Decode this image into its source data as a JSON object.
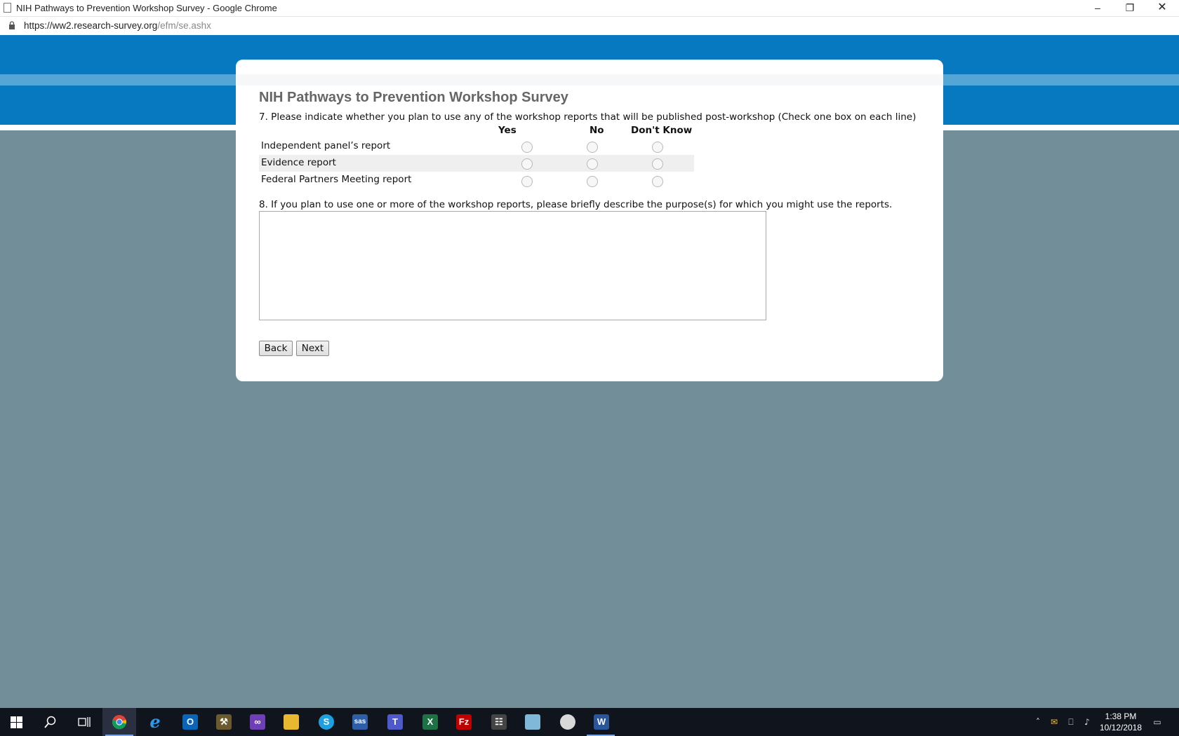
{
  "window": {
    "title": "NIH Pathways to Prevention Workshop Survey - Google Chrome",
    "url_host": "https://ww2.research-survey.org",
    "url_path": "/efm/se.ashx"
  },
  "survey": {
    "title": "NIH Pathways to Prevention Workshop Survey",
    "q7": {
      "text": "7. Please indicate whether you plan to use any of the workshop reports that will be published post-workshop (Check one box on each line)",
      "columns": [
        "Yes",
        "No",
        "Don't Know"
      ],
      "rows": [
        {
          "label": "Independent panel’s report"
        },
        {
          "label": "Evidence report"
        },
        {
          "label": "Federal Partners Meeting report"
        }
      ]
    },
    "q8": {
      "text": "8. If you plan to use one or more of the workshop reports, please briefly describe the purpose(s) for which you might use the reports.",
      "value": ""
    },
    "buttons": {
      "back": "Back",
      "next": "Next"
    }
  },
  "taskbar": {
    "apps": [
      "start-icon",
      "search-icon",
      "task-view-icon",
      "chrome-icon",
      "internet-explorer-icon",
      "outlook-icon",
      "tools-icon",
      "visual-studio-icon",
      "file-explorer-icon",
      "skype-icon",
      "sas-icon",
      "teams-icon",
      "excel-icon",
      "filezilla-icon",
      "calculator-icon",
      "notepad-icon",
      "paint-icon",
      "word-icon"
    ],
    "time": "1:38 PM",
    "date": "10/12/2018"
  }
}
